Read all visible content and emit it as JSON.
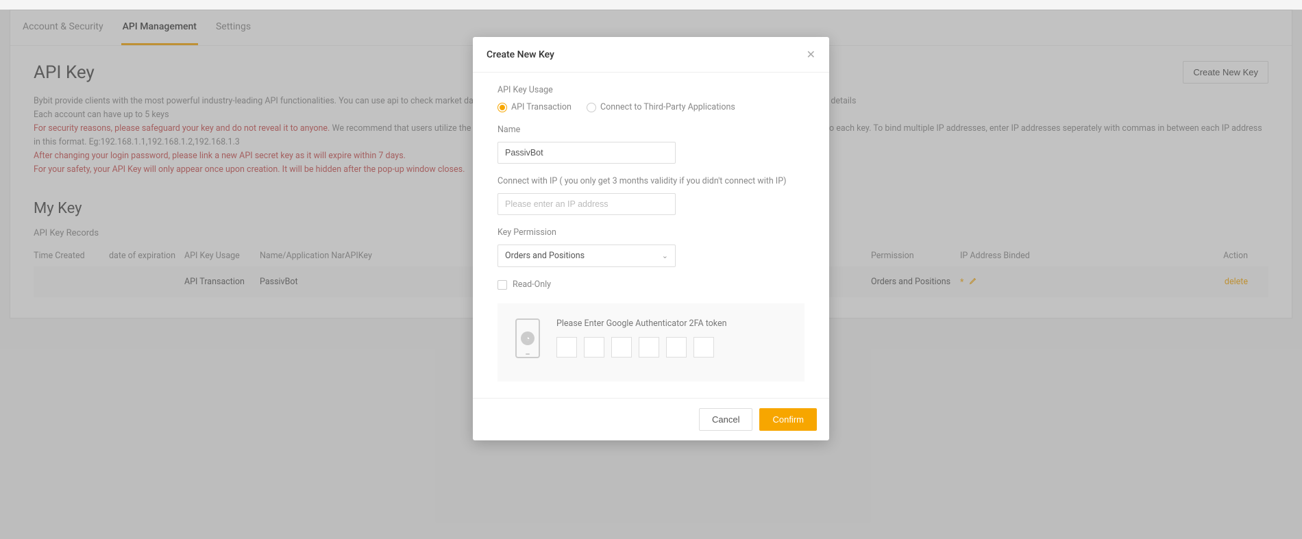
{
  "tabs": {
    "account": "Account & Security",
    "api": "API Management",
    "settings": "Settings"
  },
  "page": {
    "title": "API Key",
    "create_btn": "Create New Key",
    "desc_line1": "Bybit provide clients with the most powerful industry-leading API functionalities. You can use api to check market data, process automated trading orders and much more. Visit API Documentation page for more details",
    "desc_line2": "Each account can have up to 5 keys",
    "desc_red1": "For security reasons, please safeguard your key and do not reveal it to anyone.",
    "desc_line3": "We recommend that users utilize the IP binding functionality for increased security. Up to 4 different IP addresses can be bounded to each key. To bind multiple IP addresses, enter IP addresses seperately with commas in between each IP address in this format. Eg:192.168.1.1,192.168.1.2,192.168.1.3",
    "desc_red2": "After changing your login password, please link a new API secret key as it will expire within 7 days.",
    "desc_red3": "For your safety, your API Key will only appear once upon creation. It will be hidden after the pop-up window closes.",
    "my_key_title": "My Key",
    "records_label": "API Key Records"
  },
  "table": {
    "headers": {
      "time": "Time Created",
      "expiration": "date of expiration",
      "usage": "API Key Usage",
      "name": "Name/Application NarAPIKey",
      "apikey": "",
      "permission": "Permission",
      "ip": "IP Address Binded",
      "action": "Action"
    },
    "row": {
      "time": "",
      "expiration": "",
      "usage": "API Transaction",
      "name": "PassivBot",
      "apikey": "",
      "permission": "Orders and Positions",
      "ip_star": "*",
      "action": "delete"
    }
  },
  "modal": {
    "title": "Create New Key",
    "usage_label": "API Key Usage",
    "radio_transaction": "API Transaction",
    "radio_thirdparty": "Connect to Third-Party Applications",
    "name_label": "Name",
    "name_value": "PassivBot",
    "ip_label": "Connect with IP ( you only get 3 months validity if you didn't connect with IP)",
    "ip_placeholder": "Please enter an IP address",
    "permission_label": "Key Permission",
    "permission_value": "Orders and Positions",
    "readonly_label": "Read-Only",
    "auth_label": "Please Enter Google Authenticator 2FA token",
    "cancel": "Cancel",
    "confirm": "Confirm"
  }
}
